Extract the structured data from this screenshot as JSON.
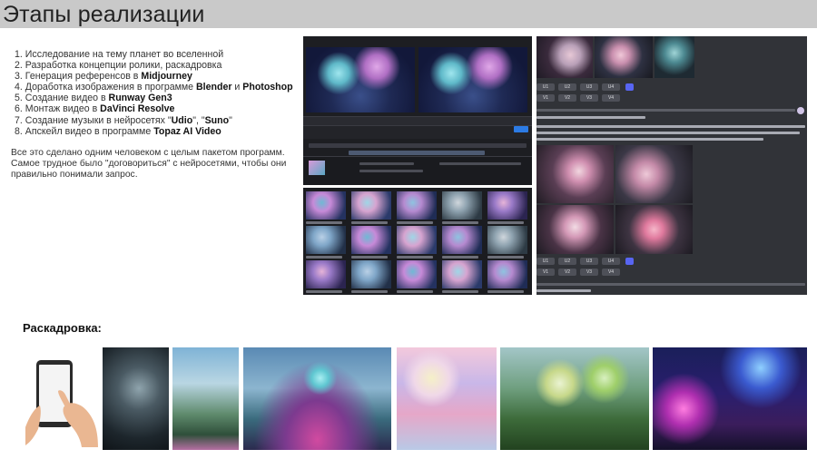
{
  "page": {
    "title": "Этапы реализации"
  },
  "steps": [
    {
      "num": "1.",
      "pre": "Исследование на тему планет во вселенной",
      "b1": "",
      "mid": "",
      "b2": "",
      "post": ""
    },
    {
      "num": "2.",
      "pre": "Разработка концепции ролики, раскадровка",
      "b1": "",
      "mid": "",
      "b2": "",
      "post": ""
    },
    {
      "num": "3.",
      "pre": "Генерация референсов в ",
      "b1": "Midjourney",
      "mid": "",
      "b2": "",
      "post": ""
    },
    {
      "num": "4.",
      "pre": "Доработка изображения в программе ",
      "b1": "Blender",
      "mid": " и ",
      "b2": "Photoshop",
      "post": ""
    },
    {
      "num": "5.",
      "pre": "Создание видео в ",
      "b1": "Runway Gen3",
      "mid": "",
      "b2": "",
      "post": ""
    },
    {
      "num": "6.",
      "pre": "Монтаж видео в ",
      "b1": "DaVinci Resolve",
      "mid": "",
      "b2": "",
      "post": ""
    },
    {
      "num": "7.",
      "pre": "Создание музыки в нейросетях \"",
      "b1": "Udio",
      "mid": "\",  \"",
      "b2": "Suno",
      "post": "\""
    },
    {
      "num": "8.",
      "pre": "Апскейл видео в программе ",
      "b1": "Topaz AI Video",
      "mid": "",
      "b2": "",
      "post": ""
    }
  ],
  "summary": {
    "line1": "Все это сделано одним человеком с целым пакетом программ.",
    "line2": "Самое трудное было \"договориться\" с нейросетями, чтобы они",
    "line3": "правильно понимали запрос."
  },
  "storyboard": {
    "title": "Раскадровка:"
  },
  "discord": {
    "buttons_row1": [
      "U1",
      "U2",
      "U3",
      "U4"
    ],
    "buttons_row2": [
      "V1",
      "V2",
      "V3",
      "V4"
    ],
    "buttons_row3": [
      "U1",
      "U2",
      "U3",
      "U4"
    ],
    "buttons_row4": [
      "V1",
      "V2",
      "V3",
      "V4"
    ]
  },
  "colors": {
    "header_bg": "#c9c9c9",
    "discord_bg": "#313338",
    "editor_bg": "#1d1e22"
  }
}
